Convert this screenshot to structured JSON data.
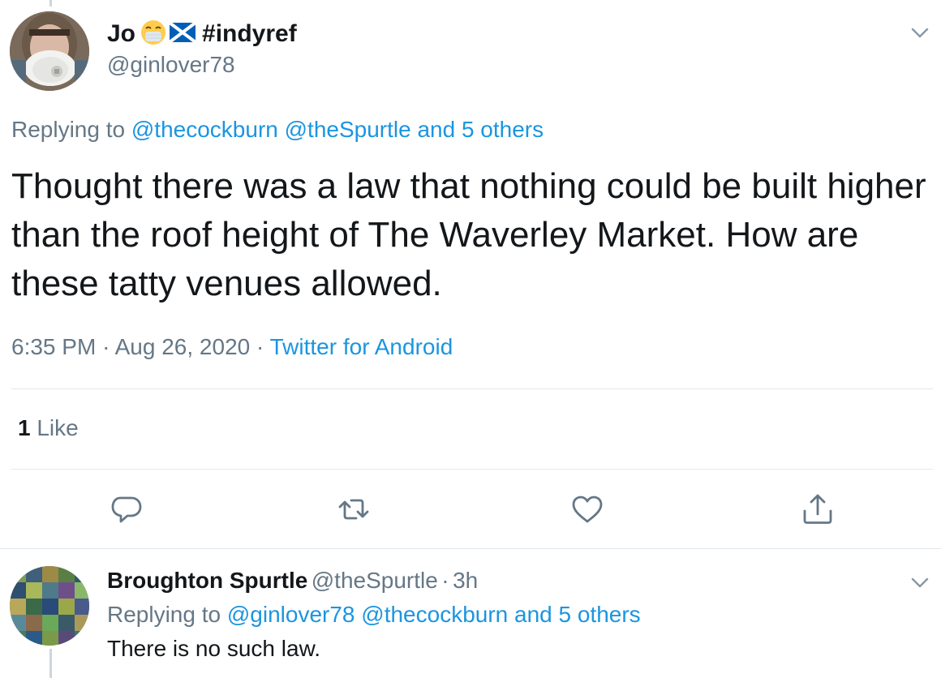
{
  "main_tweet": {
    "author_name": "Jo",
    "author_tag": "#indyref",
    "author_handle": "@ginlover78",
    "replying_prefix": "Replying to",
    "replying_mentions": "@thecockburn @theSpurtle and 5 others",
    "text": "Thought there was a law that nothing could be built higher than the roof height of The Waverley Market. How are these tatty venues allowed.",
    "time": "6:35 PM",
    "date": "Aug 26, 2020",
    "separator": "·",
    "source": "Twitter for Android",
    "like_count": "1",
    "like_label": "Like"
  },
  "reply_tweet": {
    "author_name": "Broughton Spurtle",
    "author_handle": "@theSpurtle",
    "age": "3h",
    "separator": "·",
    "replying_prefix": "Replying to",
    "replying_mentions": "@ginlover78 @thecockburn and 5 others",
    "text": "There is no such law."
  },
  "icons": {
    "more": "chevron-down-icon",
    "reply": "reply-icon",
    "retweet": "retweet-icon",
    "like": "heart-icon",
    "share": "share-icon"
  },
  "colors": {
    "link": "#1b95e0",
    "secondary": "#657786",
    "text": "#14171a",
    "divider": "#e1e8ed"
  }
}
